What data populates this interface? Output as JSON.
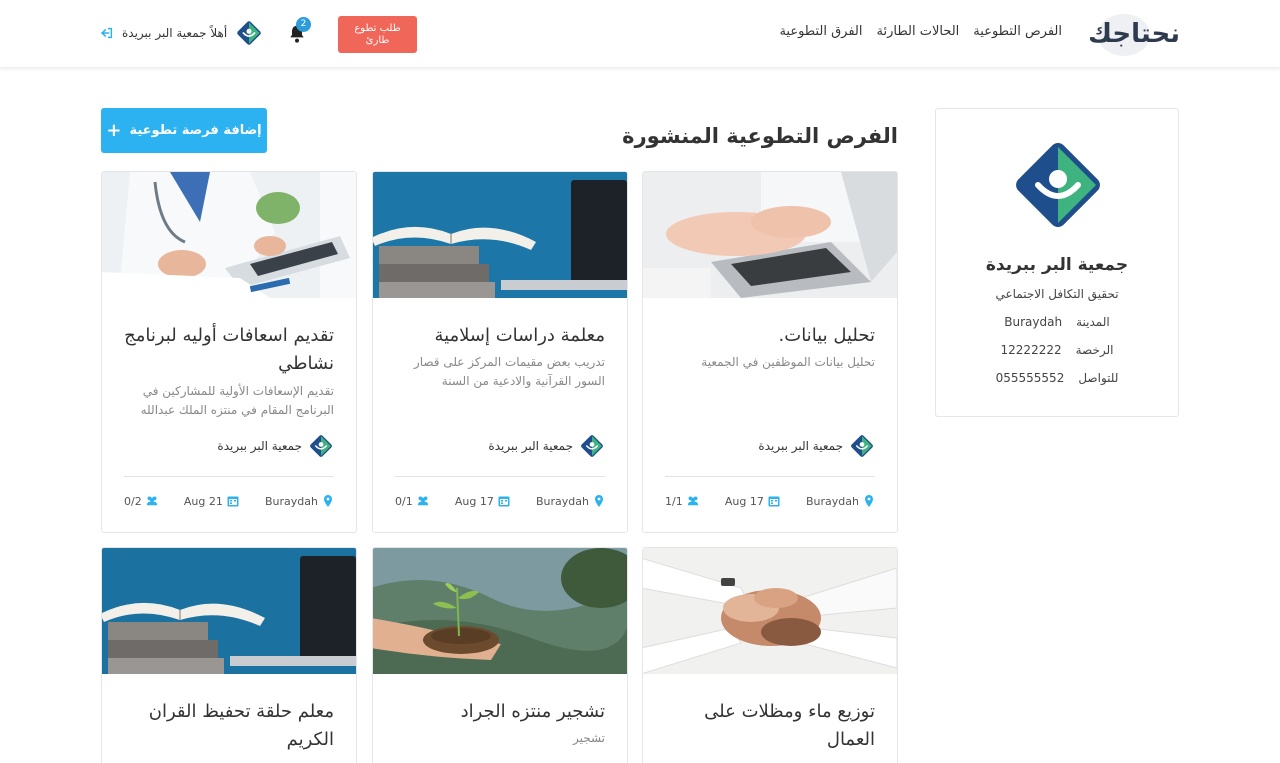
{
  "brand": {
    "name": "نحتاجك"
  },
  "nav": {
    "links": [
      "الفرص التطوعية",
      "الحالات الطارئة",
      "الفرق التطوعية"
    ]
  },
  "header": {
    "urgent_line1": "طلب تطوع",
    "urgent_line2": "طارئ",
    "notifications_count": "2",
    "greeting": "أهلاً جمعية البر ببريدة",
    "icons": [
      "bell-icon",
      "logout-icon",
      "org-logo-icon"
    ]
  },
  "profile": {
    "name": "جمعية البر ببريدة",
    "tagline": "تحقيق التكافل الاجتماعي",
    "city_label": "المدينة",
    "city_value": "Buraydah",
    "license_label": "الرخصة",
    "license_value": "12222222",
    "contact_label": "للتواصل",
    "contact_value": "055555552"
  },
  "main": {
    "title": "الفرص التطوعية المنشورة",
    "add_button": "إضافة فرصة تطوعية"
  },
  "cards": [
    {
      "title": "تحليل بيانات.",
      "desc": "تحليل بيانات الموظفين في الجمعية",
      "org": "جمعية البر ببريدة",
      "city": "Buraydah",
      "date": "Aug 17",
      "count": "1/1",
      "image": "laptop-typing"
    },
    {
      "title": "معلمة دراسات إسلامية",
      "desc": "تدريب بعض مقيمات المركز على قصار السور القرآنية والادعية من السنة",
      "org": "جمعية البر ببريدة",
      "city": "Buraydah",
      "date": "Aug 17",
      "count": "0/1",
      "image": "book-desk"
    },
    {
      "title": "تقديم اسعافات أوليه لبرنامج نشاطي",
      "desc": "تقديم الإسعافات الأولية للمشاركين في البرنامج المقام في منتزه الملك عبدالله",
      "org": "جمعية البر ببريدة",
      "city": "Buraydah",
      "date": "Aug 21",
      "count": "0/2",
      "image": "doctor-writing"
    },
    {
      "title": "توزيع ماء ومظلات على العمال",
      "desc": "",
      "image": "hands-together"
    },
    {
      "title": "تشجير منتزه الجراد",
      "desc": "تشجير",
      "image": "plant-hands"
    },
    {
      "title": "معلم حلقة تحفيظ القران الكريم",
      "desc": "",
      "image": "book-desk"
    }
  ],
  "colors": {
    "accent": "#2cb2f0",
    "urgent": "#f0675a",
    "logo_blue": "#1f4e8c",
    "logo_green": "#3fb37f"
  }
}
